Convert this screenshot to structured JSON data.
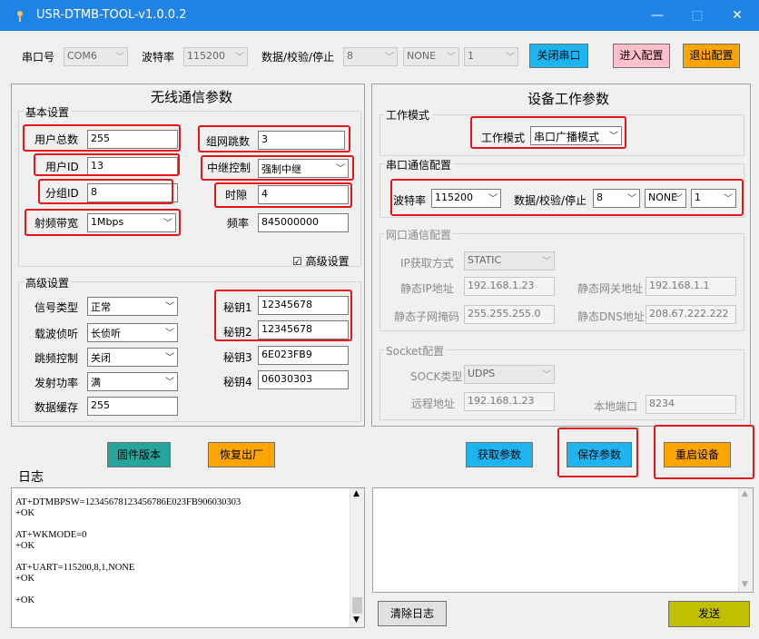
{
  "window": {
    "title": "USR-DTMB-TOOL-v1.0.0.2",
    "minimize": "—",
    "maximize": "□",
    "close": "✕"
  },
  "toolbar": {
    "port_label": "串口号",
    "port_value": "COM6",
    "baud_label": "波特率",
    "baud_value": "115200",
    "dps_label": "数据/校验/停止",
    "data_value": "8",
    "parity_value": "NONE",
    "stop_value": "1",
    "close_port": "关闭串口",
    "enter_config": "进入配置",
    "exit_config": "退出配置"
  },
  "wireless": {
    "title": "无线通信参数",
    "basic_title": "基本设置",
    "user_total_label": "用户总数",
    "user_total": "255",
    "hops_label": "组网跳数",
    "hops": "3",
    "user_id_label": "用户ID",
    "user_id": "13",
    "relay_label": "中继控制",
    "relay": "强制中继",
    "group_id_label": "分组ID",
    "group_id": "8",
    "slot_label": "时隙",
    "slot": "4",
    "bandwidth_label": "射频带宽",
    "bandwidth": "1Mbps",
    "freq_label": "频率",
    "freq": "845000000",
    "advanced_check_label": "高级设置",
    "adv_title": "高级设置",
    "signal_type_label": "信号类型",
    "signal_type": "正常",
    "carrier_label": "载波侦听",
    "carrier": "长侦听",
    "hop_ctrl_label": "跳频控制",
    "hop_ctrl": "关闭",
    "tx_power_label": "发射功率",
    "tx_power": "满",
    "buffer_label": "数据缓存",
    "buffer": "255",
    "key1_label": "秘钥1",
    "key1": "12345678",
    "key2_label": "秘钥2",
    "key2": "12345678",
    "key3_label": "秘钥3",
    "key3": "6E023FB9",
    "key4_label": "秘钥4",
    "key4": "06030303"
  },
  "device": {
    "title": "设备工作参数",
    "mode_group": "工作模式",
    "mode_label": "工作模式",
    "mode": "串口广播模式",
    "serial_group": "串口通信配置",
    "baud_label": "波特率",
    "baud": "115200",
    "dps_label": "数据/校验/停止",
    "data": "8",
    "parity": "NONE",
    "stop": "1",
    "net_group": "网口通信配置",
    "ip_mode_label": "IP获取方式",
    "ip_mode": "STATIC",
    "static_ip_label": "静态IP地址",
    "static_ip": "192.168.1.23",
    "gateway_label": "静态网关地址",
    "gateway": "192.168.1.1",
    "mask_label": "静态子网掩码",
    "mask": "255.255.255.0",
    "dns_label": "静态DNS地址",
    "dns": "208.67.222.222",
    "socket_group": "Socket配置",
    "sock_type_label": "SOCK类型",
    "sock_type": "UDPS",
    "remote_label": "远程地址",
    "remote": "192.168.1.23",
    "local_port_label": "本地端口",
    "local_port": "8234"
  },
  "actions": {
    "firmware": "固件版本",
    "factory": "恢复出厂",
    "get": "获取参数",
    "save": "保存参数",
    "restart": "重启设备"
  },
  "log": {
    "title": "日志",
    "text": "AT+DTMBPSW=12345678123456786E023FB906030303\n+OK\n\nAT+WKMODE=0\n+OK\n\nAT+UART=115200,8,1,NONE\n+OK\n\n+OK",
    "clear": "清除日志",
    "send": "发送"
  },
  "colors": {
    "accent": "#1f84e6",
    "highlight": "#e8141b",
    "teal": "#26a69a",
    "orange": "#ffa500",
    "cyan": "#1eb4f0",
    "pink": "#ffc0cb",
    "olive": "#c0c000"
  }
}
